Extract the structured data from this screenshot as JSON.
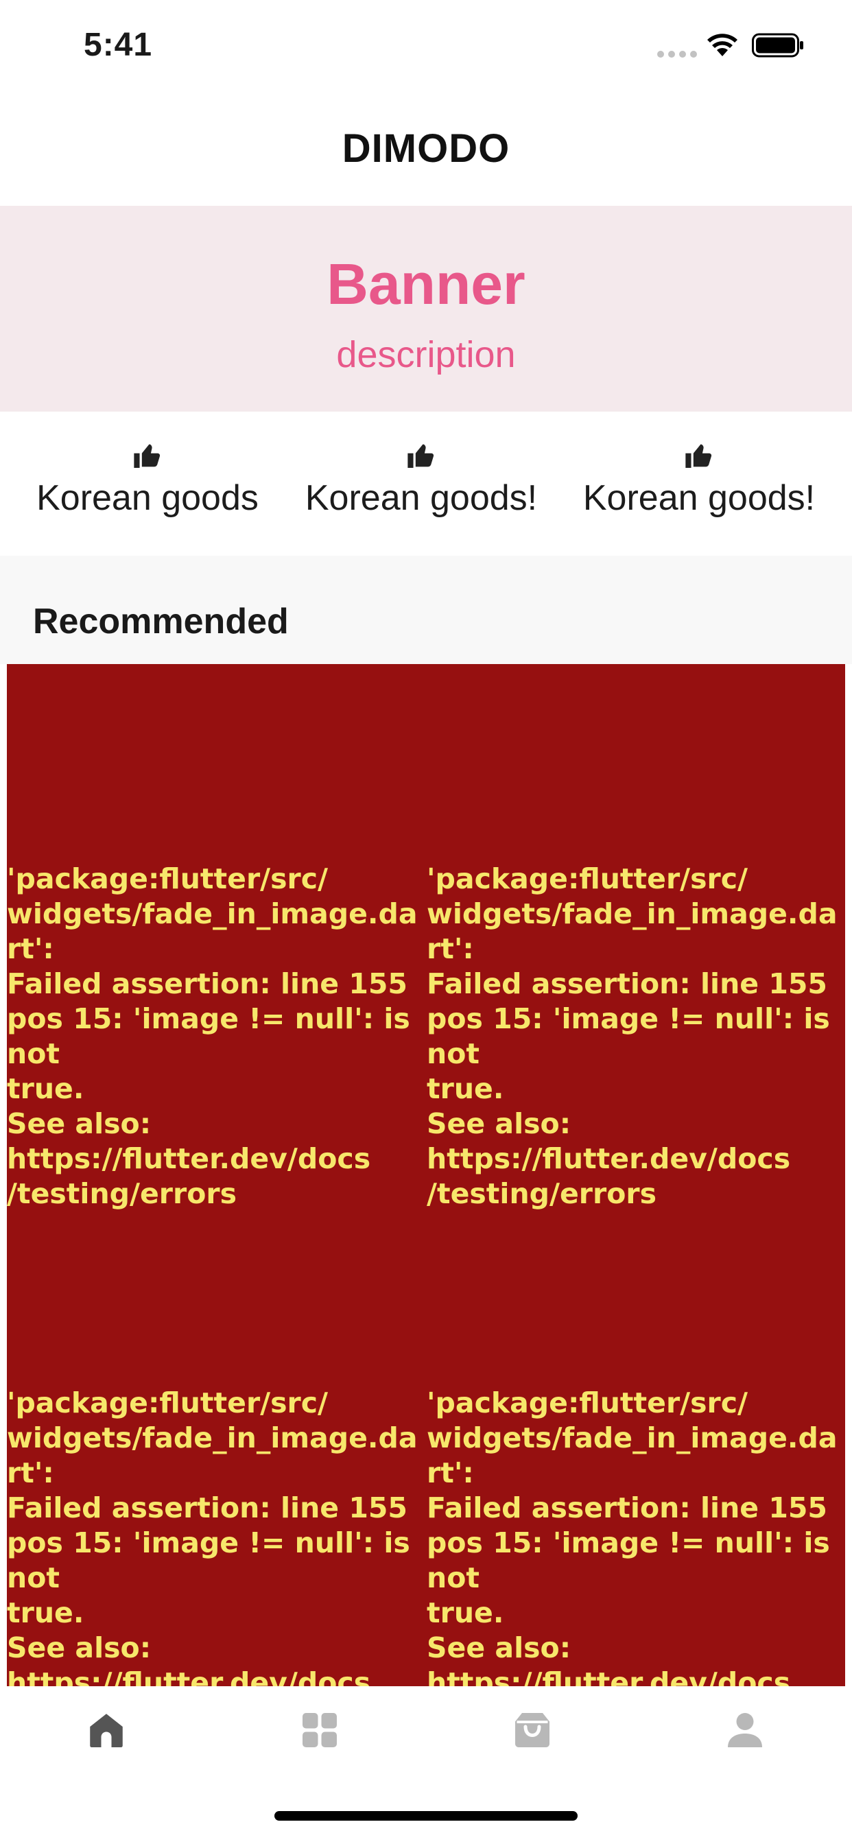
{
  "status_bar": {
    "time": "5:41"
  },
  "app_bar": {
    "title": "DIMODO"
  },
  "banner": {
    "title": "Banner",
    "description": "description",
    "background_color": "#f4e9ec",
    "text_color": "#e8588a"
  },
  "features": [
    {
      "icon": "thumb-up-icon",
      "label": "Korean goods"
    },
    {
      "icon": "thumb-up-icon",
      "label": "Korean goods!"
    },
    {
      "icon": "thumb-up-icon",
      "label": "Korean goods!"
    }
  ],
  "recommended": {
    "title": "Recommended",
    "items": [
      {
        "error_text": "'package:flutter/src/\nwidgets/fade_in_image.dart':\nFailed assertion: line 155\npos 15: 'image != null': is not\ntrue.\nSee also:\nhttps://flutter.dev/docs\n/testing/errors"
      },
      {
        "error_text": "'package:flutter/src/\nwidgets/fade_in_image.dart':\nFailed assertion: line 155\npos 15: 'image != null': is not\ntrue.\nSee also:\nhttps://flutter.dev/docs\n/testing/errors"
      },
      {
        "error_text": "'package:flutter/src/\nwidgets/fade_in_image.dart':\nFailed assertion: line 155\npos 15: 'image != null': is not\ntrue.\nSee also:\nhttps://flutter.dev/docs\n/testing/errors"
      },
      {
        "error_text": "'package:flutter/src/\nwidgets/fade_in_image.dart':\nFailed assertion: line 155\npos 15: 'image != null': is not\ntrue.\nSee also:\nhttps://flutter.dev/docs\n/testing/errors"
      }
    ],
    "error_background_color": "#961010",
    "error_text_color": "#f7e76b"
  },
  "bottom_nav": {
    "items": [
      {
        "icon": "home-icon",
        "selected": true
      },
      {
        "icon": "grid-icon",
        "selected": false
      },
      {
        "icon": "shopping-bag-icon",
        "selected": false
      },
      {
        "icon": "person-icon",
        "selected": false
      }
    ],
    "active_color": "#555555",
    "inactive_color": "#b8b8b8"
  }
}
